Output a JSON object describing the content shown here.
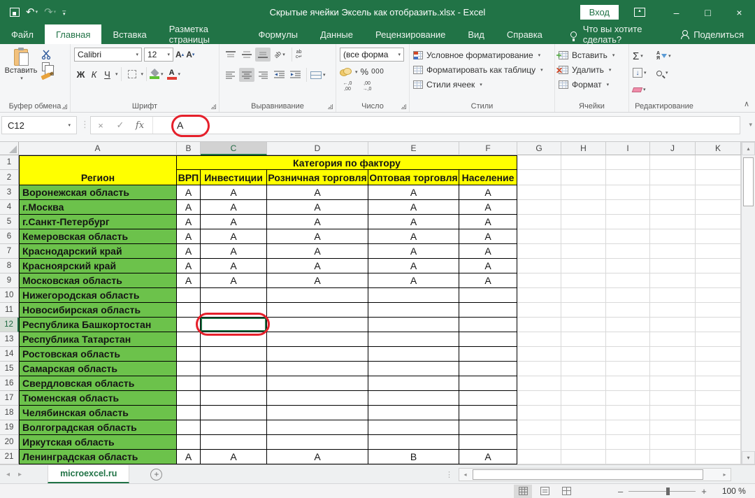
{
  "title_bar": {
    "title": "Скрытые ячейки Эксель как отобразить.xlsx - Excel",
    "sign_in": "Вход"
  },
  "ribbon": {
    "tabs": [
      "Файл",
      "Главная",
      "Вставка",
      "Разметка страницы",
      "Формулы",
      "Данные",
      "Рецензирование",
      "Вид",
      "Справка"
    ],
    "active_tab": "Главная",
    "tell_me": "Что вы хотите сделать?",
    "share": "Поделиться",
    "groups": {
      "clipboard": {
        "label": "Буфер обмена",
        "paste": "Вставить"
      },
      "font": {
        "label": "Шрифт",
        "font_name": "Calibri",
        "font_size": "12",
        "bold": "Ж",
        "italic": "К",
        "underline": "Ч",
        "color_letter": "А"
      },
      "alignment": {
        "label": "Выравнивание"
      },
      "number": {
        "label": "Число",
        "format": "(все форма"
      },
      "styles": {
        "label": "Стили",
        "conditional": "Условное форматирование",
        "format_as_table": "Форматировать как таблицу",
        "cell_styles": "Стили ячеек"
      },
      "cells": {
        "label": "Ячейки",
        "insert": "Вставить",
        "delete": "Удалить",
        "format": "Формат"
      },
      "editing": {
        "label": "Редактирование"
      }
    }
  },
  "formula_bar": {
    "name_box": "C12",
    "value": "А"
  },
  "grid": {
    "columns": [
      "A",
      "B",
      "C",
      "D",
      "E",
      "F",
      "G",
      "H",
      "I",
      "J",
      "K"
    ],
    "selected_column": "C",
    "selected_row_number": 12,
    "selected_cell": "C12",
    "category_title": "Категория по фактору",
    "region_header": "Регион",
    "factor_headers": [
      "ВРП",
      "Инвестиции",
      "Розничная торговля",
      "Оптовая торговля",
      "Население"
    ],
    "rows": [
      {
        "n": 3,
        "region": "Воронежская область",
        "values": [
          "А",
          "А",
          "А",
          "А",
          "А"
        ]
      },
      {
        "n": 4,
        "region": "г.Москва",
        "values": [
          "А",
          "А",
          "А",
          "А",
          "А"
        ]
      },
      {
        "n": 5,
        "region": "г.Санкт-Петербург",
        "values": [
          "А",
          "А",
          "А",
          "А",
          "А"
        ]
      },
      {
        "n": 6,
        "region": "Кемеровская область",
        "values": [
          "А",
          "А",
          "А",
          "А",
          "А"
        ]
      },
      {
        "n": 7,
        "region": "Краснодарский край",
        "values": [
          "А",
          "А",
          "А",
          "А",
          "А"
        ]
      },
      {
        "n": 8,
        "region": "Красноярский край",
        "values": [
          "А",
          "А",
          "А",
          "А",
          "А"
        ]
      },
      {
        "n": 9,
        "region": "Московская область",
        "values": [
          "А",
          "А",
          "А",
          "А",
          "А"
        ]
      },
      {
        "n": 10,
        "region": "Нижегородская область",
        "values": [
          "",
          "",
          "",
          "",
          ""
        ]
      },
      {
        "n": 11,
        "region": "Новосибирская область",
        "values": [
          "",
          "",
          "",
          "",
          ""
        ]
      },
      {
        "n": 12,
        "region": "Республика Башкортостан",
        "values": [
          "",
          "",
          "",
          "",
          ""
        ]
      },
      {
        "n": 13,
        "region": "Республика Татарстан",
        "values": [
          "",
          "",
          "",
          "",
          ""
        ]
      },
      {
        "n": 14,
        "region": "Ростовская область",
        "values": [
          "",
          "",
          "",
          "",
          ""
        ]
      },
      {
        "n": 15,
        "region": "Самарская область",
        "values": [
          "",
          "",
          "",
          "",
          ""
        ]
      },
      {
        "n": 16,
        "region": "Свердловская область",
        "values": [
          "",
          "",
          "",
          "",
          ""
        ]
      },
      {
        "n": 17,
        "region": "Тюменская область",
        "values": [
          "",
          "",
          "",
          "",
          ""
        ]
      },
      {
        "n": 18,
        "region": "Челябинская область",
        "values": [
          "",
          "",
          "",
          "",
          ""
        ]
      },
      {
        "n": 19,
        "region": "Волгоградская область",
        "values": [
          "",
          "",
          "",
          "",
          ""
        ]
      },
      {
        "n": 20,
        "region": "Иркутская область",
        "values": [
          "",
          "",
          "",
          "",
          ""
        ]
      },
      {
        "n": 21,
        "region": "Ленинградская область",
        "values": [
          "А",
          "А",
          "А",
          "В",
          "А"
        ]
      }
    ]
  },
  "sheet_tabs": {
    "active": "microexcel.ru"
  },
  "status_bar": {
    "zoom_level": "100 %"
  },
  "colors": {
    "brand_green": "#217346",
    "cell_green": "#6CC24B",
    "cell_yellow": "#FFFF00",
    "annotation_red": "#E5202B"
  },
  "icons": {
    "dropdown": "▾",
    "undo": "↶",
    "redo": "↷",
    "minimize": "–",
    "maximize": "□",
    "close": "×",
    "cancel": "×",
    "check": "✓",
    "fx": "fx",
    "sigma": "Σ",
    "percent": "%",
    "thousands": "000",
    "inc_decimal": "←,0 ,00",
    "dec_decimal": ",00 →,0",
    "collapse": "∧",
    "sort_top": "А",
    "sort_bottom": "Я",
    "wrap_top": "ab",
    "wrap_bottom": "c↵",
    "orientation": "ab",
    "grow_font": "А",
    "shrink_font": "А",
    "caret_up": "▲",
    "caret_down": "▼",
    "arrow_down": "↓",
    "plus": "+",
    "prev": "◂",
    "next": "▸",
    "up": "▴",
    "down": "▾",
    "left": "◂",
    "right": "▸",
    "dots": "⋮",
    "hdots": "⋮⋮",
    "minus": "–"
  }
}
